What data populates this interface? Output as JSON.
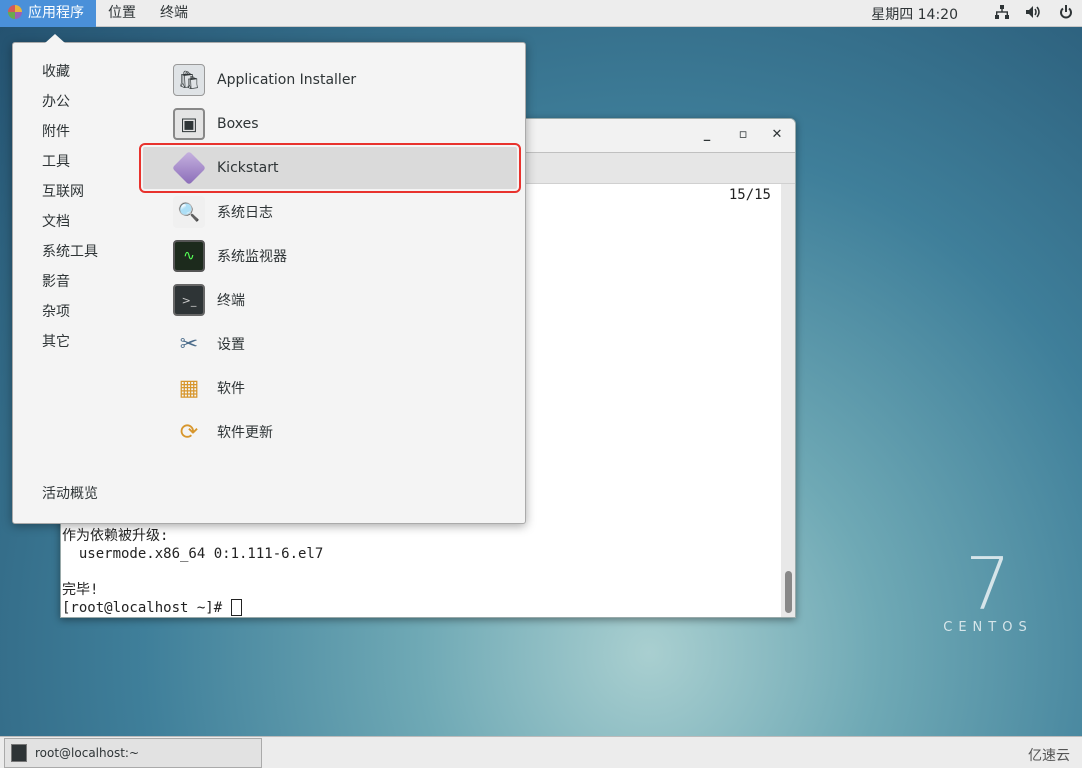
{
  "topbar": {
    "applications": "应用程序",
    "places": "位置",
    "terminal": "终端",
    "clock": "星期四 14:20",
    "icons": [
      "network-icon",
      "volume-icon",
      "power-icon"
    ]
  },
  "menu": {
    "categories": [
      "收藏",
      "办公",
      "附件",
      "工具",
      "互联网",
      "文档",
      "系统工具",
      "影音",
      "杂项",
      "其它"
    ],
    "activities": "活动概览",
    "apps": [
      {
        "label": "Application Installer",
        "icon": "application-installer-icon"
      },
      {
        "label": "Boxes",
        "icon": "boxes-icon"
      },
      {
        "label": "Kickstart",
        "icon": "kickstart-icon",
        "selected": true
      },
      {
        "label": "系统日志",
        "icon": "system-log-icon"
      },
      {
        "label": "系统监视器",
        "icon": "system-monitor-icon"
      },
      {
        "label": "终端",
        "icon": "terminal-icon"
      },
      {
        "label": "设置",
        "icon": "settings-icon"
      },
      {
        "label": "软件",
        "icon": "software-icon"
      },
      {
        "label": "软件更新",
        "icon": "software-update-icon"
      }
    ],
    "highlight_color": "#e8322d"
  },
  "terminal": {
    "page_count": "15/15",
    "lines": [
      "作为依赖被升级:",
      "  usermode.x86_64 0:1.111-6.el7",
      "",
      "完毕!"
    ],
    "prompt": "[root@localhost ~]# "
  },
  "taskbar": {
    "task": "root@localhost:~",
    "watermark": "亿速云"
  },
  "logo": {
    "number": "7",
    "word": "CENTOS"
  }
}
